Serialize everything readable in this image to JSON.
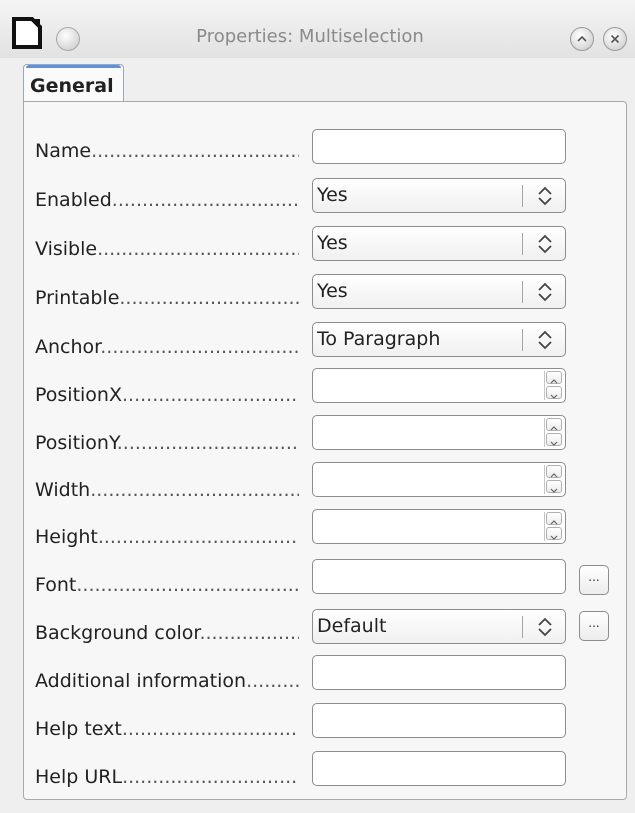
{
  "window": {
    "title": "Properties: Multiselection"
  },
  "tabs": [
    {
      "label": "General",
      "active": true
    }
  ],
  "fields": [
    {
      "label": "Name",
      "type": "text",
      "value": ""
    },
    {
      "label": "Enabled",
      "type": "select",
      "value": "Yes"
    },
    {
      "label": "Visible",
      "type": "select",
      "value": "Yes"
    },
    {
      "label": "Printable",
      "type": "select",
      "value": "Yes"
    },
    {
      "label": "Anchor",
      "type": "select",
      "value": "To Paragraph"
    },
    {
      "label": "PositionX",
      "type": "spin",
      "value": ""
    },
    {
      "label": "PositionY",
      "type": "spin",
      "value": ""
    },
    {
      "label": "Width",
      "type": "spin",
      "value": ""
    },
    {
      "label": "Height",
      "type": "spin",
      "value": ""
    },
    {
      "label": "Font",
      "type": "text",
      "value": "",
      "ellipsis": "..."
    },
    {
      "label": "Background color",
      "type": "select",
      "value": "Default",
      "ellipsis": "..."
    },
    {
      "label": "Additional information",
      "type": "text",
      "value": ""
    },
    {
      "label": "Help text",
      "type": "text",
      "value": ""
    },
    {
      "label": "Help URL",
      "type": "text",
      "value": ""
    }
  ],
  "colors": {
    "tab_accent": "#5f92d8",
    "window_bg": "#efefef"
  }
}
